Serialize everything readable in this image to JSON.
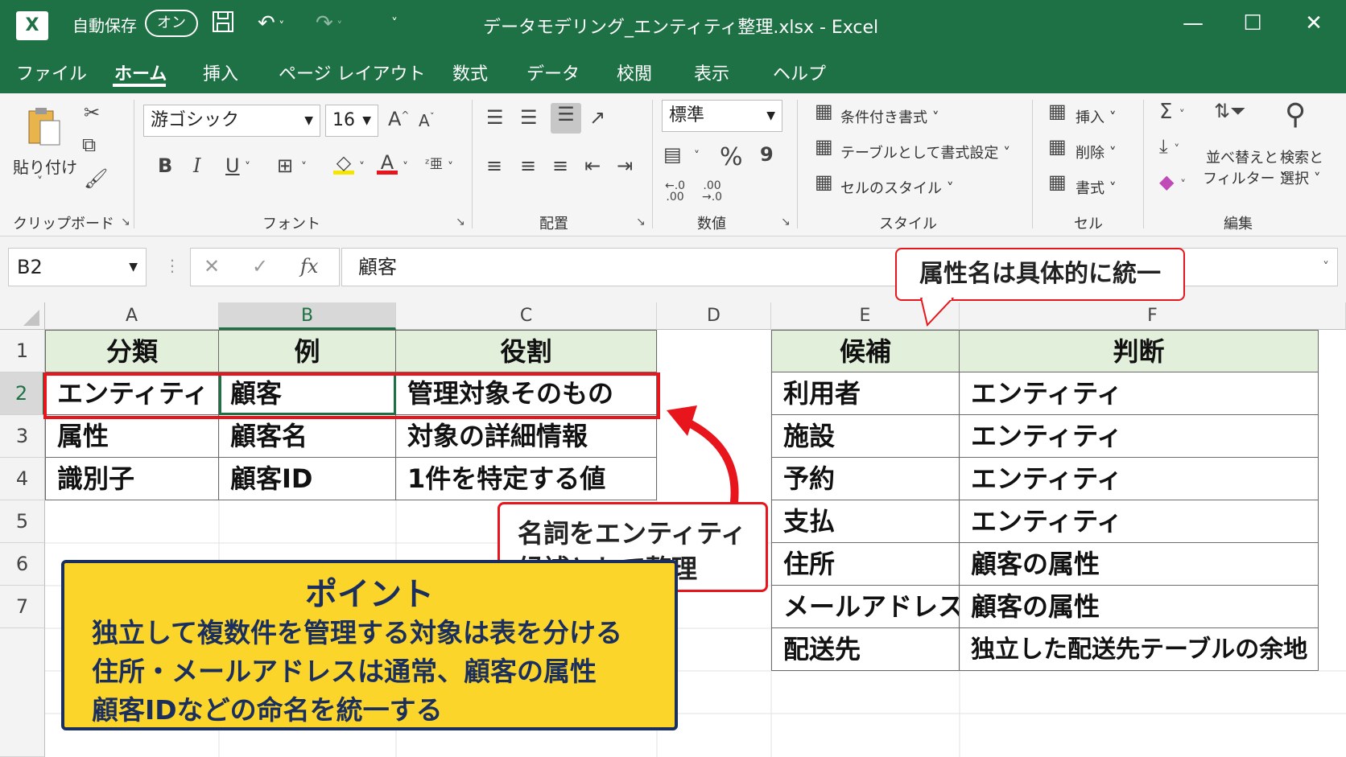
{
  "titlebar": {
    "logo": "X",
    "autosave_label": "自動保存",
    "autosave_state": "オン",
    "save_icon": "save-icon",
    "undo_icon": "undo-icon",
    "redo_icon": "redo-icon",
    "doc_title": "データモデリング_エンティティ整理.xlsx  -  Excel",
    "minimize": "—",
    "maximize": "☐",
    "close": "✕"
  },
  "menu": {
    "tabs": [
      "ファイル",
      "ホーム",
      "挿入",
      "ページ レイアウト",
      "数式",
      "データ",
      "校閲",
      "表示",
      "ヘルプ"
    ],
    "active": "ホーム"
  },
  "ribbon": {
    "clipboard": {
      "paste_label": "貼り付け",
      "group_label": "クリップボード"
    },
    "font": {
      "name": "游ゴシック",
      "size": "16",
      "grow": "A^",
      "shrink": "Aˇ",
      "bold": "B",
      "italic": "I",
      "underline": "U",
      "group_label": "フォント"
    },
    "alignment": {
      "group_label": "配置"
    },
    "number": {
      "format": "標準",
      "percent": "%",
      "comma": "9",
      "inc_decimal": "←.0\n.00",
      "dec_decimal": ".00\n→.0",
      "group_label": "数値"
    },
    "styles": {
      "conditional": "条件付き書式",
      "as_table": "テーブルとして書式設定",
      "cell_styles": "セルのスタイル",
      "group_label": "スタイル"
    },
    "cells": {
      "insert": "挿入",
      "delete": "削除",
      "format": "書式",
      "group_label": "セル"
    },
    "editing": {
      "sort_filter_1": "並べ替えと",
      "sort_filter_2": "フィルター",
      "find_1": "検索と",
      "find_2": "選択",
      "group_label": "編集"
    }
  },
  "formula_bar": {
    "name_box": "B2",
    "cancel": "✕",
    "enter": "✓",
    "fx": "fx",
    "content": "顧客"
  },
  "grid": {
    "columns": [
      "A",
      "B",
      "C",
      "D",
      "E",
      "F"
    ],
    "rows": [
      "1",
      "2",
      "3",
      "4",
      "5",
      "6",
      "7"
    ],
    "selected_cell": "B2",
    "left_table": {
      "headers": [
        "分類",
        "例",
        "役割"
      ],
      "rows": [
        [
          "エンティティ",
          "顧客",
          "管理対象そのもの"
        ],
        [
          "属性",
          "顧客名",
          "対象の詳細情報"
        ],
        [
          "識別子",
          "顧客ID",
          "1件を特定する値"
        ]
      ]
    },
    "right_table": {
      "headers": [
        "候補",
        "判断"
      ],
      "rows": [
        [
          "利用者",
          "エンティティ"
        ],
        [
          "施設",
          "エンティティ"
        ],
        [
          "予約",
          "エンティティ"
        ],
        [
          "支払",
          "エンティティ"
        ],
        [
          "住所",
          "顧客の属性"
        ],
        [
          "メールアドレス",
          "顧客の属性"
        ],
        [
          "配送先",
          "独立した配送先テーブルの余地"
        ]
      ]
    }
  },
  "annotations": {
    "callout_top": "属性名は具体的に統一",
    "callout_mid_1": "名詞をエンティティ",
    "callout_mid_2": "候補として整理",
    "accent_color": "#e8151d",
    "point": {
      "title": "ポイント",
      "lines": [
        "独立して複数件を管理する対象は表を分ける",
        "住所・メールアドレスは通常、顧客の属性",
        "顧客IDなどの命名を統一する"
      ],
      "bg_color": "#fcd52a"
    }
  }
}
